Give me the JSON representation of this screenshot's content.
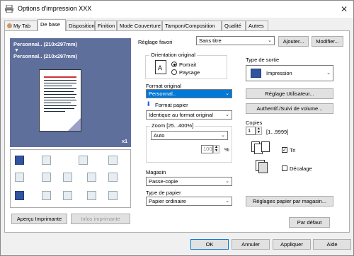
{
  "window": {
    "title": "Options d'impression XXX",
    "close": "✕"
  },
  "tabs": [
    "My Tab",
    "De base",
    "Disposition",
    "Finition",
    "Mode Couverture",
    "Tampon/Composition",
    "Qualité",
    "Autres"
  ],
  "preview": {
    "line1": "Personnal.. (210x297mm)",
    "arrow": "▼",
    "line2": "Personnal.. (210x297mm)",
    "copies": "x1"
  },
  "left_buttons": {
    "preview": "Aperçu Imprimante",
    "printer_info": "Infos imprimante"
  },
  "favorite": {
    "label": "Réglage favori",
    "value": "Sans titre",
    "add": "Ajouter...",
    "modify": "Modifier..."
  },
  "orientation": {
    "label": "Orientation original",
    "options": [
      "Portrait",
      "Paysage"
    ],
    "selected": "Portrait"
  },
  "format_original": {
    "label": "Format original",
    "value": "Personnal.."
  },
  "format_papier": {
    "label": "Format papier",
    "value": "Identique au format original"
  },
  "zoom": {
    "label": "Zoom [25...400%]",
    "value": "Auto",
    "percent": "100",
    "unit": "%"
  },
  "magasin": {
    "label": "Magasin",
    "value": "Passe-copie"
  },
  "type_papier": {
    "label": "Type de papier",
    "value": "Papier ordinaire"
  },
  "sortie": {
    "label": "Type de sortie",
    "value": "Impression"
  },
  "right_buttons": {
    "user_setting": "Réglage Utilisateur...",
    "auth": "Authentif./Suivi de volume...",
    "paper_tray": "Réglages papier par magasin..."
  },
  "copies": {
    "label": "Copies",
    "value": "1",
    "range": "[1...9999]",
    "sort": "Tri",
    "sort_checked": true,
    "offset": "Décalage",
    "offset_checked": false
  },
  "default_button": "Par défaut",
  "footer": {
    "ok": "OK",
    "cancel": "Annuler",
    "apply": "Appliquer",
    "help": "Aide"
  }
}
